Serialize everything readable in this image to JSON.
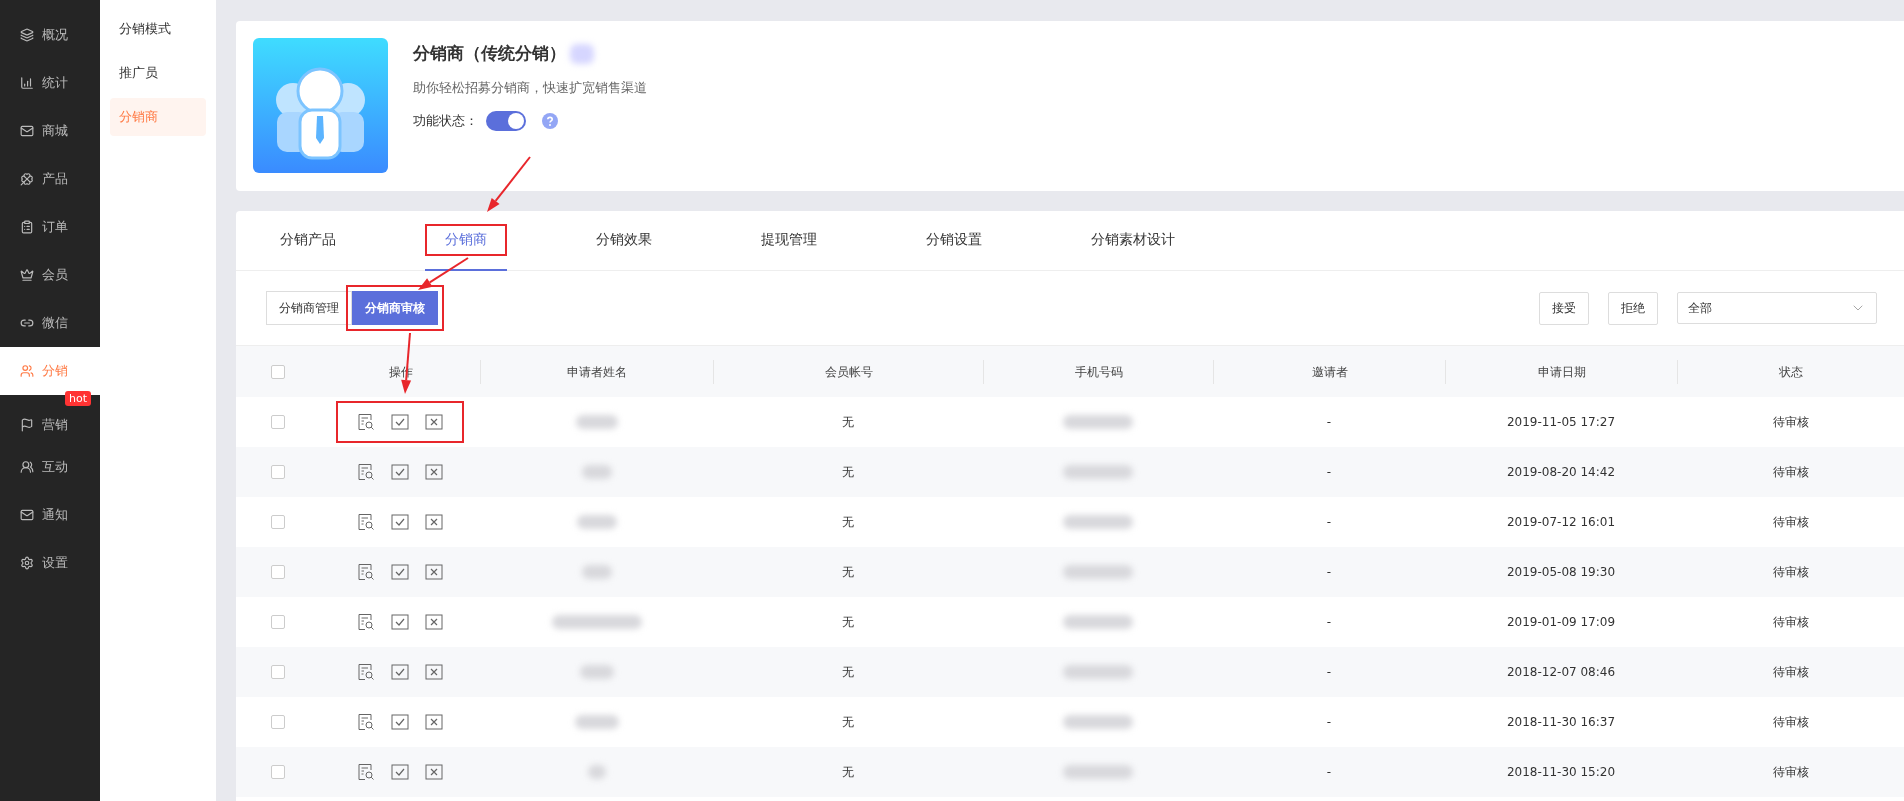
{
  "sidebar": {
    "items": [
      {
        "label": "概况",
        "selected": false
      },
      {
        "label": "统计",
        "selected": false
      },
      {
        "label": "商城",
        "selected": false
      },
      {
        "label": "产品",
        "selected": false
      },
      {
        "label": "订单",
        "selected": false
      },
      {
        "label": "会员",
        "selected": false
      },
      {
        "label": "微信",
        "selected": false
      },
      {
        "label": "分销",
        "selected": true
      },
      {
        "label": "营销",
        "selected": false,
        "badge": "hot"
      },
      {
        "label": "互动",
        "selected": false
      },
      {
        "label": "通知",
        "selected": false
      },
      {
        "label": "设置",
        "selected": false
      }
    ]
  },
  "subnav": {
    "items": [
      {
        "label": "分销模式",
        "selected": false
      },
      {
        "label": "推广员",
        "selected": false
      },
      {
        "label": "分销商",
        "selected": true
      }
    ]
  },
  "feature": {
    "title": "分销商（传统分销）",
    "description": "助你轻松招募分销商，快速扩宽销售渠道",
    "status_label": "功能状态：",
    "enabled": true
  },
  "tabs": [
    {
      "label": "分销产品",
      "selected": false,
      "highlighted": false
    },
    {
      "label": "分销商",
      "selected": true,
      "highlighted": true
    },
    {
      "label": "分销效果",
      "selected": false,
      "highlighted": false
    },
    {
      "label": "提现管理",
      "selected": false,
      "highlighted": false
    },
    {
      "label": "分销设置",
      "selected": false,
      "highlighted": false
    },
    {
      "label": "分销素材设计",
      "selected": false,
      "highlighted": false
    }
  ],
  "view_buttons": [
    {
      "label": "分销商管理",
      "selected": false,
      "highlighted": false
    },
    {
      "label": "分销商审核",
      "selected": true,
      "highlighted": true
    }
  ],
  "actions": [
    "接受",
    "拒绝"
  ],
  "filter": {
    "value": "全部"
  },
  "table": {
    "columns": [
      "操作",
      "申请者姓名",
      "会员帐号",
      "手机号码",
      "邀请者",
      "申请日期",
      "状态"
    ],
    "all_checked": false,
    "rows": [
      {
        "checked": false,
        "highlighted": true,
        "account": "无",
        "inviter": "-",
        "date": "2019-11-05 17:27",
        "status": "待审核"
      },
      {
        "checked": false,
        "highlighted": false,
        "account": "无",
        "inviter": "-",
        "date": "2019-08-20 14:42",
        "status": "待审核"
      },
      {
        "checked": false,
        "highlighted": false,
        "account": "无",
        "inviter": "-",
        "date": "2019-07-12 16:01",
        "status": "待审核"
      },
      {
        "checked": false,
        "highlighted": false,
        "account": "无",
        "inviter": "-",
        "date": "2019-05-08 19:30",
        "status": "待审核"
      },
      {
        "checked": false,
        "highlighted": false,
        "account": "无",
        "inviter": "-",
        "date": "2019-01-09 17:09",
        "status": "待审核"
      },
      {
        "checked": false,
        "highlighted": false,
        "account": "无",
        "inviter": "-",
        "date": "2018-12-07 08:46",
        "status": "待审核"
      },
      {
        "checked": false,
        "highlighted": false,
        "account": "无",
        "inviter": "-",
        "date": "2018-11-30 16:37",
        "status": "待审核"
      },
      {
        "checked": false,
        "highlighted": false,
        "account": "无",
        "inviter": "-",
        "date": "2018-11-30 15:20",
        "status": "待审核"
      }
    ]
  }
}
